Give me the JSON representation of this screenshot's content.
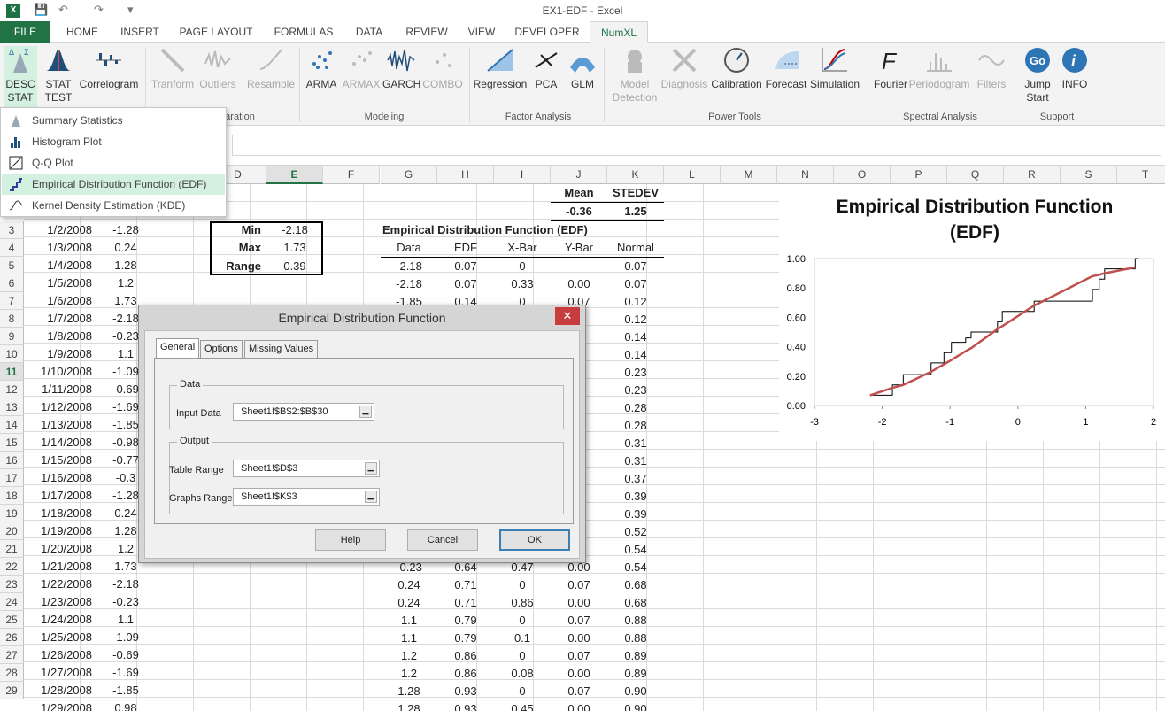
{
  "window": {
    "title": "EX1-EDF - Excel"
  },
  "tabs": [
    "FILE",
    "HOME",
    "INSERT",
    "PAGE LAYOUT",
    "FORMULAS",
    "DATA",
    "REVIEW",
    "VIEW",
    "DEVELOPER",
    "NumXL"
  ],
  "ribbon": {
    "desc_stat": "DESC",
    "desc_stat2": "STAT",
    "stat_test": "STAT",
    "stat_test2": "TEST",
    "correlogram": "Correlogram",
    "transform": "Tranform",
    "outliers": "Outliers",
    "resample": "Resample",
    "arma": "ARMA",
    "armax": "ARMAX",
    "garch": "GARCH",
    "combo": "COMBO",
    "regression": "Regression",
    "pca": "PCA",
    "glm": "GLM",
    "model_detection": "Model",
    "model_detection2": "Detection",
    "diagnosis": "Diagnosis",
    "calibration": "Calibration",
    "forecast": "Forecast",
    "simulation": "Simulation",
    "fourier": "Fourier",
    "periodogram": "Periodogram",
    "filters": "Filters",
    "jump_start": "Jump",
    "jump_start2": "Start",
    "info": "INFO",
    "groups": {
      "preparation": "aration",
      "modeling": "Modeling",
      "factor": "Factor Analysis",
      "power": "Power Tools",
      "spectral": "Spectral Analysis",
      "support": "Support"
    }
  },
  "dropdown": [
    "Summary Statistics",
    "Histogram Plot",
    "Q-Q Plot",
    "Empirical Distribution Function (EDF)",
    "Kernel Density Estimation (KDE)"
  ],
  "columns": [
    "D",
    "E",
    "F",
    "G",
    "H",
    "I",
    "J",
    "K",
    "L",
    "M",
    "N",
    "O",
    "P",
    "Q",
    "R",
    "S",
    "T"
  ],
  "rows": [
    "3",
    "4",
    "5",
    "6",
    "7",
    "8",
    "9",
    "10",
    "11",
    "12",
    "13",
    "14",
    "15",
    "16",
    "17",
    "18",
    "19",
    "20",
    "21",
    "22",
    "23",
    "24",
    "25",
    "26",
    "27",
    "28",
    "29"
  ],
  "sheet": {
    "dates": [
      "1/2/2008",
      "1/3/2008",
      "1/4/2008",
      "1/5/2008",
      "1/6/2008",
      "1/7/2008",
      "1/8/2008",
      "1/9/2008",
      "1/10/2008",
      "1/11/2008",
      "1/12/2008",
      "1/13/2008",
      "1/14/2008",
      "1/15/2008",
      "1/16/2008",
      "1/17/2008",
      "1/18/2008",
      "1/19/2008",
      "1/20/2008",
      "1/21/2008",
      "1/22/2008",
      "1/23/2008",
      "1/24/2008",
      "1/25/2008",
      "1/26/2008",
      "1/27/2008",
      "1/28/2008",
      "1/29/2008"
    ],
    "values": [
      "-1.28",
      "0.24",
      "1.28",
      "1.2",
      "1.73",
      "-2.18",
      "-0.23",
      "1.1",
      "-1.09",
      "-0.69",
      "-1.69",
      "-1.85",
      "-0.98",
      "-0.77",
      "-0.3",
      "-1.28",
      "0.24",
      "1.28",
      "1.2",
      "1.73",
      "-2.18",
      "-0.23",
      "1.1",
      "-1.09",
      "-0.69",
      "-1.69",
      "-1.85",
      "0.98"
    ],
    "stats": {
      "min_label": "Min",
      "min": "-2.18",
      "max_label": "Max",
      "max": "1.73",
      "range_label": "Range",
      "range": "0.39"
    },
    "mean_label": "Mean",
    "mean": "-0.36",
    "stdev_label": "STEDEV",
    "stdev": "1.25",
    "edf_title": "Empirical Distribution Function (EDF)",
    "edf_headers": [
      "Data",
      "EDF",
      "X-Bar",
      "Y-Bar",
      "Normal"
    ],
    "edf_rows": [
      [
        "-2.18",
        "0.07",
        "0",
        "",
        "0.07"
      ],
      [
        "-2.18",
        "0.07",
        "0.33",
        "0.00",
        "0.07"
      ],
      [
        "-1.85",
        "0.14",
        "0",
        "0.07",
        "0.12"
      ],
      [
        "",
        "",
        "",
        "",
        "0.12"
      ],
      [
        "",
        "",
        "",
        "",
        "0.14"
      ],
      [
        "",
        "",
        "",
        "",
        "0.14"
      ],
      [
        "",
        "",
        "",
        "",
        "0.23"
      ],
      [
        "",
        "",
        "",
        "",
        "0.23"
      ],
      [
        "",
        "",
        "",
        "",
        "0.28"
      ],
      [
        "",
        "",
        "",
        "",
        "0.28"
      ],
      [
        "",
        "",
        "",
        "",
        "0.31"
      ],
      [
        "",
        "",
        "",
        "",
        "0.31"
      ],
      [
        "",
        "",
        "",
        "",
        "0.37"
      ],
      [
        "",
        "",
        "",
        "",
        "0.39"
      ],
      [
        "",
        "",
        "",
        "",
        "0.39"
      ],
      [
        "",
        "",
        "",
        "",
        "0.52"
      ],
      [
        "",
        "",
        "",
        "",
        "0.54"
      ],
      [
        "-0.23",
        "0.64",
        "0.47",
        "0.00",
        "0.54"
      ],
      [
        "0.24",
        "0.71",
        "0",
        "0.07",
        "0.68"
      ],
      [
        "0.24",
        "0.71",
        "0.86",
        "0.00",
        "0.68"
      ],
      [
        "1.1",
        "0.79",
        "0",
        "0.07",
        "0.88"
      ],
      [
        "1.1",
        "0.79",
        "0.1",
        "0.00",
        "0.88"
      ],
      [
        "1.2",
        "0.86",
        "0",
        "0.07",
        "0.89"
      ],
      [
        "1.2",
        "0.86",
        "0.08",
        "0.00",
        "0.89"
      ],
      [
        "1.28",
        "0.93",
        "0",
        "0.07",
        "0.90"
      ],
      [
        "1.28",
        "0.93",
        "0.45",
        "0.00",
        "0.90"
      ]
    ]
  },
  "dialog": {
    "title": "Empirical Distribution Function",
    "tabs": [
      "General",
      "Options",
      "Missing Values"
    ],
    "data_legend": "Data",
    "input_label": "Input Data",
    "input_value": "Sheet1!$B$2:$B$30",
    "output_legend": "Output",
    "table_label": "Table Range",
    "table_value": "Sheet1!$D$3",
    "graphs_label": "Graphs Range",
    "graphs_value": "Sheet1!$K$3",
    "help": "Help",
    "cancel": "Cancel",
    "ok": "OK",
    "close": "✕"
  },
  "chart_data": {
    "type": "line",
    "title": "Empirical Distribution Function (EDF)",
    "xlim": [
      -3,
      2
    ],
    "ylim": [
      0,
      1
    ],
    "xticks": [
      "-3",
      "-2",
      "-1",
      "0",
      "1",
      "2"
    ],
    "yticks": [
      "0.00",
      "0.20",
      "0.40",
      "0.60",
      "0.80",
      "1.00"
    ],
    "series": [
      {
        "kind": "step",
        "color": "#000000",
        "x": [
          -2.18,
          -1.85,
          -1.69,
          -1.28,
          -1.09,
          -0.98,
          -0.77,
          -0.69,
          -0.3,
          -0.23,
          0.24,
          1.1,
          1.2,
          1.28,
          1.73
        ],
        "y": [
          0.07,
          0.14,
          0.21,
          0.29,
          0.36,
          0.43,
          0.46,
          0.5,
          0.57,
          0.64,
          0.71,
          0.79,
          0.86,
          0.93,
          1.0
        ]
      },
      {
        "kind": "smooth",
        "color": "#c0504d",
        "x": [
          -2.18,
          -1.85,
          -1.69,
          -1.28,
          -1.09,
          -0.98,
          -0.77,
          -0.69,
          -0.3,
          -0.23,
          0.24,
          1.1,
          1.2,
          1.28,
          1.73
        ],
        "y": [
          0.07,
          0.12,
          0.14,
          0.23,
          0.28,
          0.31,
          0.37,
          0.39,
          0.52,
          0.54,
          0.68,
          0.88,
          0.89,
          0.9,
          0.94
        ]
      }
    ]
  }
}
